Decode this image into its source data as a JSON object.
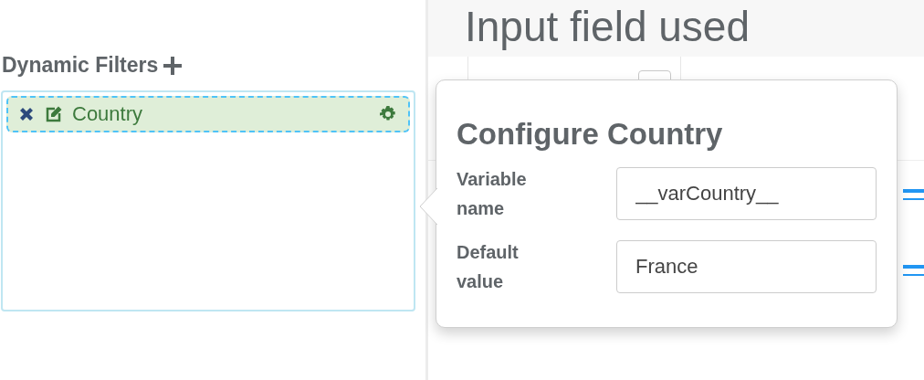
{
  "page_heading": "Input field used",
  "dynamic_filters": {
    "title": "Dynamic Filters",
    "filters": [
      {
        "label": "Country",
        "selected": true
      }
    ]
  },
  "popover": {
    "title": "Configure Country",
    "fields": [
      {
        "label": "Variable name",
        "value": "__varCountry__"
      },
      {
        "label": "Default value",
        "value": "France"
      }
    ]
  }
}
